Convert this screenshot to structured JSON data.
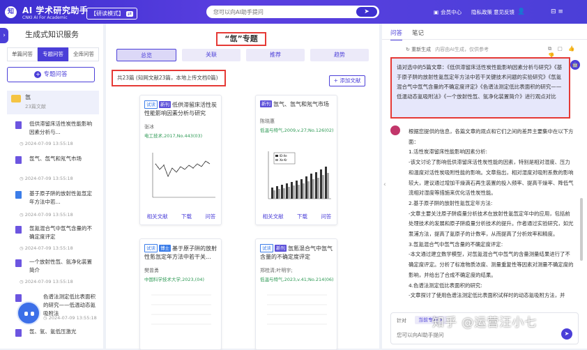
{
  "header": {
    "logo_glyph": "知",
    "app_title": "AI 学术研究助手",
    "app_subtitle": "CNKI AI For Academic",
    "mode_label": "【研读模式】",
    "mode_switch": "⇄",
    "search_placeholder": "您可以向AI助手提问",
    "search_button": "➤",
    "nav": {
      "member_icon": "▣",
      "member": "会员中心",
      "privacy": "隐私政策",
      "feedback": "意见反馈",
      "user_icon": "👤"
    },
    "window_icons": "⊟ ≡"
  },
  "sidebar": {
    "toggle": "›",
    "title": "生成式知识服务",
    "tabs": [
      "单篇问答",
      "专题问答",
      "全库问答"
    ],
    "active_tab": "专题问答",
    "new_button": "专题问答",
    "folder": {
      "name": "氙",
      "count": "23篇文献"
    },
    "history": [
      {
        "title": "低供滞留床活性炭性能影响因素分析与...",
        "date": "2024-07-09 13:55:18"
      },
      {
        "title": "氙气、氙气和氖气市场",
        "date": "2024-07-09 13:55:18"
      },
      {
        "title": "基于原子阱的放射性氪氙定年方法中若...",
        "date": "2024-07-09 13:55:18"
      },
      {
        "title": "氙氪混合气中氙气含量的不确定度评定",
        "date": "2024-07-09 13:55:18"
      },
      {
        "title": "一个放射性氙、氩净化装置简介",
        "date": "2024-07-09 13:55:18"
      },
      {
        "title": "色谱法测定低比表面积的研究——低温动态氪吸附法",
        "date": "2024-07-09 13:55:18"
      },
      {
        "title": "氙、氩、氪低压激光"
      }
    ]
  },
  "main": {
    "title": "“氙”专题",
    "tabs": [
      "总览",
      "关联",
      "推荐",
      "趋势"
    ],
    "doc_count": "共23篇 (知网文献23篇，本地上传文档0篇)",
    "add_doc": "+ 添加文献",
    "cards": [
      {
        "tags": [
          "试读",
          "新刊"
        ],
        "title": "低供滞留床活性炭性能影响因素分析与研究",
        "author": "张冰",
        "source": "电工技术,2017,No.443(03)",
        "actions": [
          "相关文献",
          "下载",
          "问答"
        ]
      },
      {
        "tags": [
          "新刊"
        ],
        "title": "氙气、氙气和氖气市场",
        "author": "陈晓惠",
        "source": "低温与特气,2009,v.27;No.126(02)",
        "actions": [
          "相关文献",
          "下载",
          "问答"
        ],
        "legend": [
          "ID-Xe",
          "Xe-Kr"
        ]
      },
      {
        "tags": [
          "试读",
          "博士"
        ],
        "title": "基于原子阱的放射性氪氙定年方法中若干关...",
        "author": "樊曾勇",
        "source": "中国科学技术大学,2023,(04)",
        "actions": []
      },
      {
        "tags": [
          "试读",
          "新刊"
        ],
        "title": "氙氪混合气中氙气含量的不确定度评定",
        "author": "郑桂清;叶明宇;",
        "source": "低温与特气,2023,v.41;No.214(06)",
        "actions": []
      }
    ]
  },
  "right": {
    "collapse": "‹",
    "tabs": [
      "问答",
      "笔记"
    ],
    "active_tab": "问答",
    "regenerate": "↻ 重新生成",
    "ai_note": "内容由AI生成，仅供参考",
    "tool_icons": "⧉ ▢ 👍 👎",
    "question": "请对选中的5篇文章：《低供滞留床活性炭性能影响因素分析与研究》《基于原子阱的放射性氪氙定年方法中若干关键技术问题的实验研究》《氙氪混合气中氙气含量的不确定度评定》《色谱法测定低比表面积的研究——低温动态氪吸附法》《一个放射性氙、氩净化装置简介》进行观点对比",
    "answer": [
      "根据您提供的信息，各篇文章的观点和它们之间的差异主要集中在以下方面：",
      "1.活性炭滞留床性能影响因素分析:",
      "-该文讨论了影响低供滞留床活性炭性能的因素，特别是相对湿度、压力和温度对活性炭吸附性能的影响。文章指出，相对湿度对吸附系数的影响较大，建议通过增加干燥滴石再生装置的投入频率、提高干燥率、降低气流相对湿度等措施来优化活性炭性能。",
      "2.基于原子阱的放射性氪氙定年方法:",
      "-文章主要关注原子阱痕量分析技术在放射性氪氙定年中的应用，包括前处理技术的发展和原子阱痕量分析技术的提升。作者通过实验研究，如光泵浦方法，提高了氪原子的计数率，从而提高了分析效率和精度。",
      "3.氙氪混合气中氙气含量的不确定度评定:",
      "-本文通过建立数学模型，对氙氪混合气中氙气的含量测量结果进行了不确定度评定。分析了标准物质浓度、测量重复性等因素对测量不确定度的影响，并给出了合成不确定度的结果。",
      "4.色谱法测定低比表面积的研究:",
      "-文章探讨了使用色谱法测定低比表面积试样时的动态氪吸附方法，并"
    ],
    "input_label": "针对",
    "input_tag": "当前专题 ×",
    "input_placeholder": "您可以向AI助手提问",
    "send": "➤",
    "scroll_icon": "⌄",
    "ai_icon": "🤖"
  },
  "watermark": "知乎 @运营汪小七",
  "colors": {
    "brand": "#4b3fd8",
    "highlight": "#e53935",
    "source_green": "#2e9a55"
  }
}
